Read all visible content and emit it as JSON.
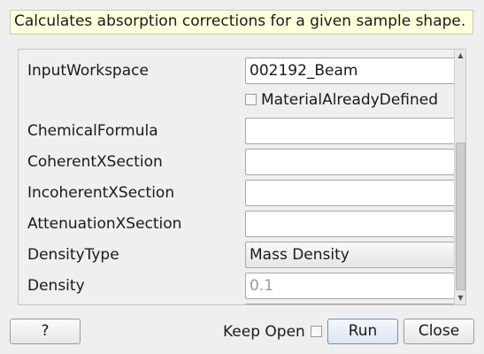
{
  "description": "Calculates absorption corrections for a given sample shape.",
  "properties": {
    "input_workspace": {
      "label": "InputWorkspace",
      "value": "002192_Beam"
    },
    "material_already_defined": {
      "label": "MaterialAlreadyDefined",
      "checked": false
    },
    "chemical_formula": {
      "label": "ChemicalFormula",
      "value": ""
    },
    "coherent_xsection": {
      "label": "CoherentXSection",
      "value": ""
    },
    "incoherent_xsection": {
      "label": "IncoherentXSection",
      "value": ""
    },
    "attenuation_xsection": {
      "label": "AttenuationXSection",
      "value": ""
    },
    "density_type": {
      "label": "DensityType",
      "value": "Mass Density"
    },
    "density": {
      "label": "Density",
      "placeholder": "0.1"
    }
  },
  "footer": {
    "help_label": "?",
    "keep_open_label": "Keep Open",
    "keep_open_checked": false,
    "run_label": "Run",
    "close_label": "Close"
  },
  "scrollbar": {
    "up_icon": "scroll-up-arrow",
    "down_icon": "scroll-down-arrow"
  }
}
